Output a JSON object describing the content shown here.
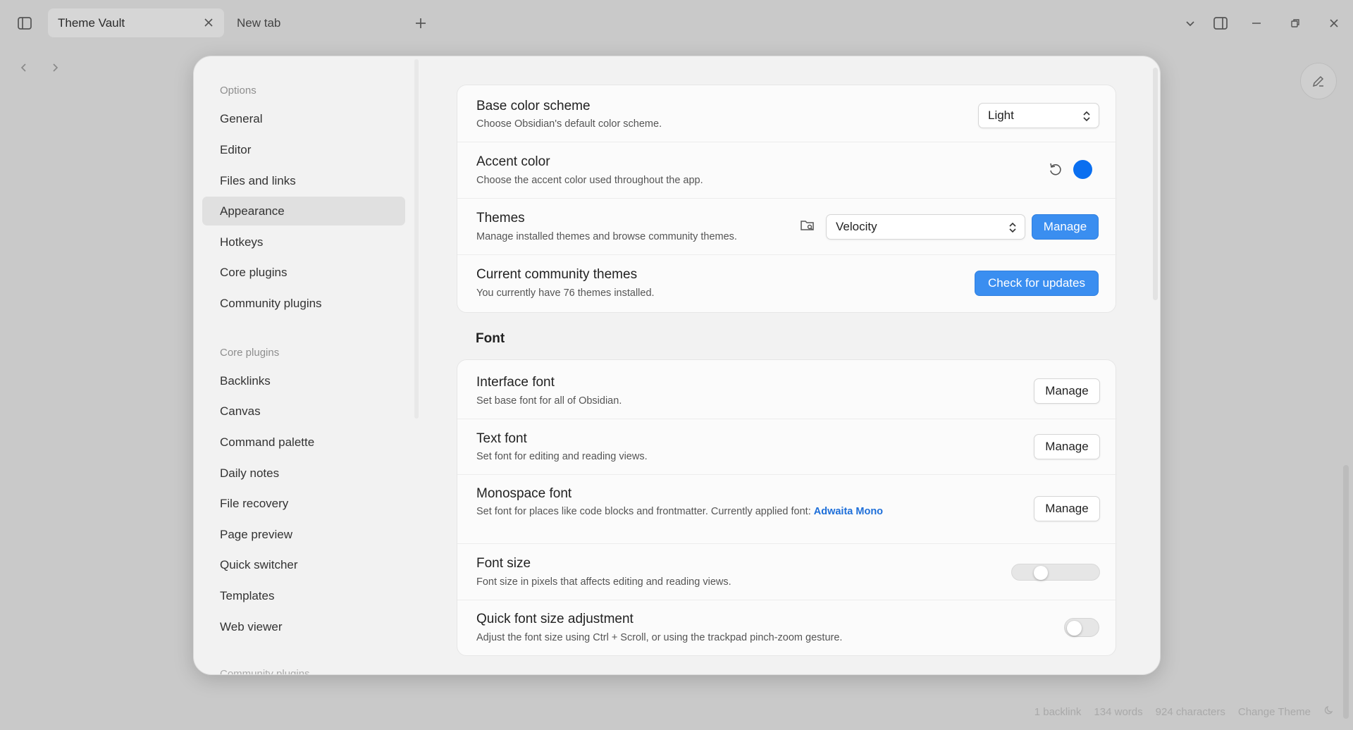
{
  "tabs": [
    {
      "label": "Theme Vault",
      "active": true
    },
    {
      "label": "New tab",
      "active": false
    }
  ],
  "icons": {
    "sidebar_toggle": "sidebar-toggle-icon",
    "new_tab": "plus-icon",
    "tab_list": "chevron-down-icon",
    "right_panel": "panel-right-icon",
    "minimize": "minimize-icon",
    "restore": "restore-icon",
    "close": "close-icon",
    "back": "chevron-left-icon",
    "forward": "chevron-right-icon",
    "edit": "pencil-icon"
  },
  "sidebar": {
    "options_title": "Options",
    "options_items": [
      "General",
      "Editor",
      "Files and links",
      "Appearance",
      "Hotkeys",
      "Core plugins",
      "Community plugins"
    ],
    "active_item": "Appearance",
    "core_title": "Core plugins",
    "core_items": [
      "Backlinks",
      "Canvas",
      "Command palette",
      "Daily notes",
      "File recovery",
      "Page preview",
      "Quick switcher",
      "Templates",
      "Web viewer"
    ],
    "faded_title": "Community plugins"
  },
  "settings": {
    "base_color": {
      "title": "Base color scheme",
      "desc": "Choose Obsidian's default color scheme.",
      "value": "Light"
    },
    "accent": {
      "title": "Accent color",
      "desc": "Choose the accent color used throughout the app.",
      "color": "#0a6ff0"
    },
    "themes": {
      "title": "Themes",
      "desc": "Manage installed themes and browse community themes.",
      "value": "Velocity",
      "button": "Manage"
    },
    "community": {
      "title": "Current community themes",
      "desc": "You currently have 76 themes installed.",
      "button": "Check for updates"
    },
    "font_heading": "Font",
    "interface_font": {
      "title": "Interface font",
      "desc": "Set base font for all of Obsidian.",
      "button": "Manage"
    },
    "text_font": {
      "title": "Text font",
      "desc": "Set font for editing and reading views.",
      "button": "Manage"
    },
    "mono_font": {
      "title": "Monospace font",
      "desc": "Set font for places like code blocks and frontmatter. Currently applied font: ",
      "link": "Adwaita Mono",
      "button": "Manage"
    },
    "font_size": {
      "title": "Font size",
      "desc": "Font size in pixels that affects editing and reading views.",
      "slider_fraction": 0.28
    },
    "quick_font": {
      "title": "Quick font size adjustment",
      "desc": "Adjust the font size using Ctrl + Scroll, or using the trackpad pinch-zoom gesture.",
      "enabled": false
    }
  },
  "statusbar": {
    "backlinks": "1 backlink",
    "words": "134 words",
    "chars": "924 characters",
    "theme": "Change Theme"
  },
  "colors": {
    "accent_blue": "#3a8ef0"
  }
}
